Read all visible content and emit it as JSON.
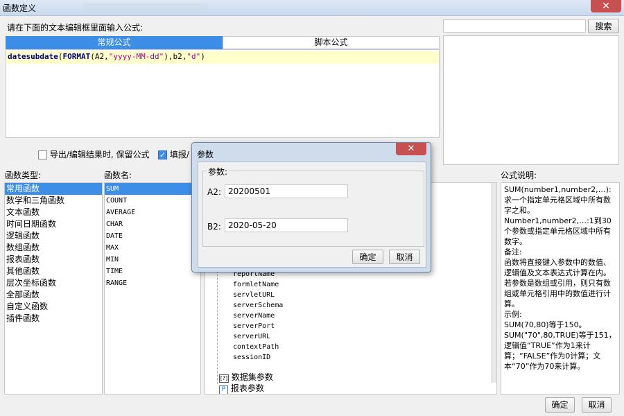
{
  "window": {
    "title": "函数定义"
  },
  "instruction": "请在下面的文本编辑框里面输入公式:",
  "search": {
    "value": "",
    "button_label": "搜索"
  },
  "tabs": [
    {
      "label": "常规公式"
    },
    {
      "label": "脚本公式"
    }
  ],
  "editor": {
    "tokens": [
      {
        "text": "datesubdate",
        "kind": "kw"
      },
      {
        "text": "(",
        "kind": "plain"
      },
      {
        "text": "FORMAT",
        "kind": "kw"
      },
      {
        "text": "(A2,",
        "kind": "plain"
      },
      {
        "text": "\"yyyy-MM-dd\"",
        "kind": "str"
      },
      {
        "text": "),b2,",
        "kind": "plain"
      },
      {
        "text": "\"d\"",
        "kind": "str"
      },
      {
        "text": ")",
        "kind": "plain"
      }
    ]
  },
  "options": {
    "keep_formula": {
      "label": "导出/编辑结果时, 保留公式",
      "checked": false
    },
    "fill_partial": {
      "label": "填报/",
      "checked": true
    }
  },
  "func_types": {
    "header": "函数类型:",
    "items": [
      "常用函数",
      "数学和三角函数",
      "文本函数",
      "时间日期函数",
      "逻辑函数",
      "数组函数",
      "报表函数",
      "其他函数",
      "层次坐标函数",
      "全部函数",
      "自定义函数",
      "插件函数"
    ],
    "selected": 0
  },
  "func_names": {
    "header": "函数名:",
    "items": [
      "SUM",
      "COUNT",
      "AVERAGE",
      "CHAR",
      "DATE",
      "MAX",
      "MIN",
      "TIME",
      "RANGE"
    ],
    "selected": 0
  },
  "params_tree": {
    "items": [
      "reportName",
      "formletName",
      "servletURL",
      "serverSchema",
      "serverName",
      "serverPort",
      "serverURL",
      "contextPath",
      "sessionID"
    ],
    "groups": [
      "数据集参数",
      "报表参数"
    ]
  },
  "description": {
    "header": "公式说明:",
    "lines": [
      "SUM(number1,number2,…):求一个指定单元格区域中所有数字之和。",
      "Number1,number2,…:1到30个参数或指定单元格区域中所有数字。",
      "备注:",
      "函数将直接键入参数中的数值、逻辑值及文本表达式计算在内。若参数是数组或引用，则只有数组或单元格引用中的数值进行计算。",
      "示例:",
      "SUM(70,80)等于150。",
      "SUM(\"70\",80,TRUE)等于151，逻辑值“TRUE”作为1来计算；“FALSE”作为0计算；文本“70”作为70来计算。"
    ]
  },
  "footer": {
    "ok_label": "确定",
    "cancel_label": "取消"
  },
  "dialog": {
    "title": "参数",
    "group_label": "参数:",
    "fields": [
      {
        "label": "A2:",
        "value": "20200501"
      },
      {
        "label": "B2:",
        "value": "2020-05-20"
      }
    ],
    "ok_label": "确定",
    "cancel_label": "取消"
  },
  "colors": {
    "accent": "#3c8ee6",
    "keyword": "#00007f",
    "string": "#a0008c",
    "editor_line": "#ffffcc"
  }
}
